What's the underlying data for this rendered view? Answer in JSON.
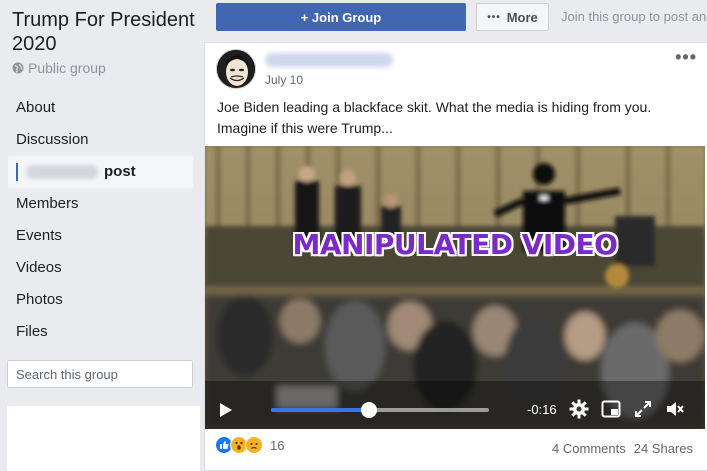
{
  "group": {
    "title": "Trump For President 2020",
    "privacy_label": "Public group"
  },
  "nav": {
    "items": [
      {
        "label": "About"
      },
      {
        "label": "Discussion"
      },
      {
        "label": "post"
      },
      {
        "label": "Members"
      },
      {
        "label": "Events"
      },
      {
        "label": "Videos"
      },
      {
        "label": "Photos"
      },
      {
        "label": "Files"
      }
    ]
  },
  "search": {
    "placeholder": "Search this group",
    "icon": "search-icon"
  },
  "header": {
    "join_label": "+ Join Group",
    "more_label": "More",
    "join_hint": "Join this group to post and"
  },
  "post": {
    "date": "July 10",
    "text": "Joe Biden leading a blackface skit. What the media is hiding from you. Imagine if this were Trump...",
    "menu": "•••"
  },
  "video": {
    "overlay_label": "MANIPULATED VIDEO",
    "time_remaining": "-0:16",
    "progress_fraction": 0.45
  },
  "footer": {
    "reaction_count": "16",
    "comments": "4 Comments",
    "shares": "24 Shares"
  },
  "colors": {
    "accent": "#4267b2",
    "overlay_text": "#7a2bc7",
    "progress": "#3578e5"
  }
}
